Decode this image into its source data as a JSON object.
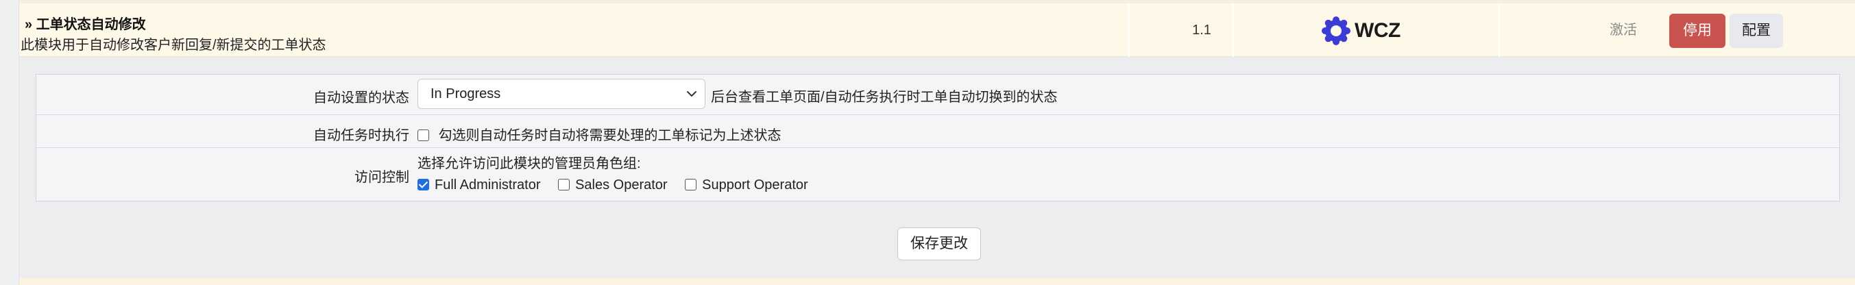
{
  "module": {
    "name": "» 工单状态自动修改",
    "description": "此模块用于自动修改客户新回复/新提交的工单状态",
    "version": "1.1",
    "vendor_logo_text": "WCZ",
    "status_text": "激活",
    "disable_button": "停用",
    "config_button": "配置"
  },
  "config": {
    "auto_status": {
      "label": "自动设置的状态",
      "selected": "In Progress",
      "hint": "后台查看工单页面/自动任务执行时工单自动切换到的状态"
    },
    "cron": {
      "label": "自动任务时执行",
      "checkbox_label": "勾选则自动任务时自动将需要处理的工单标记为上述状态",
      "checked": false
    },
    "access": {
      "label": "访问控制",
      "intro": "选择允许访问此模块的管理员角色组:",
      "roles": [
        {
          "name": "Full Administrator",
          "checked": true
        },
        {
          "name": "Sales Operator",
          "checked": false
        },
        {
          "name": "Support Operator",
          "checked": false
        }
      ]
    }
  },
  "save_button": "保存更改",
  "colors": {
    "accent_blue": "#1f6fe0",
    "danger": "#c9534f",
    "module_row_bg": "#fdf8e8"
  }
}
